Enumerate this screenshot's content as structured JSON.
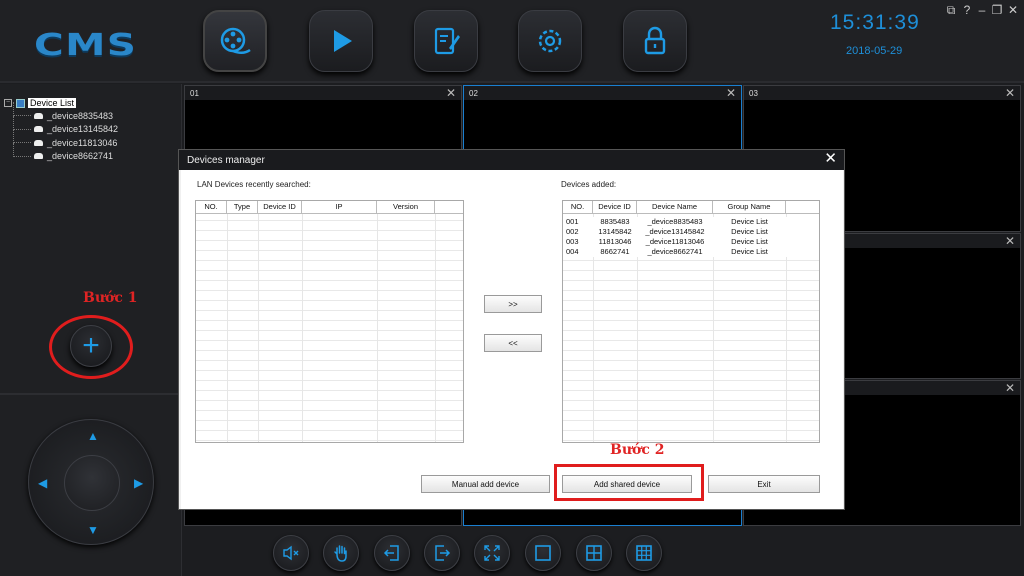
{
  "app": {
    "logo": "CMS",
    "clock_time": "15:31:39",
    "clock_date": "2018-05-29",
    "accent_color": "#1e8fd8",
    "window_controls": [
      "network-status-icon",
      "help-icon",
      "minimize-icon",
      "restore-icon",
      "close-icon"
    ],
    "window_control_glyphs": [
      "⧉",
      "?",
      "–",
      "❐",
      "✕"
    ]
  },
  "top_nav": [
    {
      "name": "video-reel-icon",
      "active": true
    },
    {
      "name": "play-icon",
      "active": false
    },
    {
      "name": "edit-document-icon",
      "active": false
    },
    {
      "name": "gear-icon",
      "active": false
    },
    {
      "name": "lock-icon",
      "active": false
    }
  ],
  "tree": {
    "root_label": "Device List",
    "expander": "−",
    "devices": [
      "_device8835483",
      "_device13145842",
      "_device11813046",
      "_device8662741"
    ]
  },
  "annotations": {
    "step1": "Bước 1",
    "step2": "Bước 2",
    "highlight_color": "#e01d1d"
  },
  "add_button_glyph": "+",
  "ptz": {
    "up": "▲",
    "down": "▼",
    "left": "◀",
    "right": "▶"
  },
  "tiles": [
    {
      "label": "01",
      "close": "✕"
    },
    {
      "label": "02",
      "close": "✕"
    },
    {
      "label": "03",
      "close": "✕"
    },
    {
      "label": "",
      "close": "✕"
    },
    {
      "label": "",
      "close": "✕"
    }
  ],
  "bottom_bar": [
    "mute-icon",
    "hand-icon",
    "exit-left-icon",
    "exit-right-icon",
    "fullscreen-icon",
    "layout-1-icon",
    "layout-4-icon",
    "layout-9-icon"
  ],
  "dialog": {
    "title": "Devices manager",
    "close": "✕",
    "lan_caption": "LAN Devices recently searched:",
    "lan_columns": [
      "NO.",
      "Type",
      "Device ID",
      "IP",
      "Version"
    ],
    "added_caption": "Devices added:",
    "added_columns": [
      "NO.",
      "Device ID",
      "Device Name",
      "Group Name"
    ],
    "added_rows": [
      [
        "001",
        "8835483",
        "_device8835483",
        "Device List"
      ],
      [
        "002",
        "13145842",
        "_device13145842",
        "Device List"
      ],
      [
        "003",
        "11813046",
        "_device11813046",
        "Device List"
      ],
      [
        "004",
        "8662741",
        "_device8662741",
        "Device List"
      ]
    ],
    "move_right": ">>",
    "move_left": "<<",
    "manual_add": "Manual add device",
    "add_shared": "Add shared device",
    "exit": "Exit"
  }
}
